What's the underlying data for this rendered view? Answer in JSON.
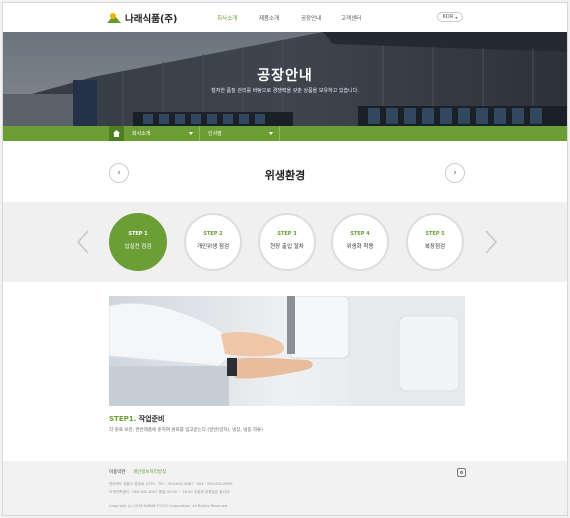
{
  "header": {
    "logo_text": "나래식품(주)",
    "nav": [
      "회사소개",
      "제품소개",
      "공장안내",
      "고객센터"
    ],
    "lang": "KOR"
  },
  "hero": {
    "title": "공장안내",
    "subtitle": "철저한 품질 관리를 바탕으로 경쟁력을 갖춘 상품을 보유하고 있습니다."
  },
  "subnav": {
    "crumb1": "회사소개",
    "crumb2": "인사말"
  },
  "section": {
    "title": "위생환경",
    "prev_icon": "chevron-left-icon",
    "next_icon": "chevron-right-icon"
  },
  "steps": [
    {
      "num": "STEP 1",
      "label": "입실전 점검"
    },
    {
      "num": "STEP 2",
      "label": "개인위생 점검"
    },
    {
      "num": "STEP 3",
      "label": "현장 출입 절차"
    },
    {
      "num": "STEP 4",
      "label": "위생화 착용"
    },
    {
      "num": "STEP 5",
      "label": "복장점검"
    }
  ],
  "detail": {
    "heading_step": "STEP1.",
    "heading_title": "작업준비",
    "desc": "각 원료 보관, 완반제품에 준하여 원료를 입고받는다.(일반(일자), 냉장, 냉동 하류)"
  },
  "footer": {
    "link1": "이용약관",
    "link2": "개인정보처리방침",
    "line1": "전라북도 정읍시 중앙로 1270  ·  TEL : 063-642-8587  ·  FAX : 063-642-8599",
    "line2": "고객만족센터 : 063-642-8587  평일 09:00 ~ 18:00 주말과 공휴일은 쉽니다.",
    "copyright": "Copyright (c) 2018 NARAE FOOD Corporation. All Rights Reserved.",
    "instagram_icon": "instagram-icon"
  },
  "colors": {
    "accent": "#6b9e35",
    "accent_dark": "#4f7d22"
  }
}
